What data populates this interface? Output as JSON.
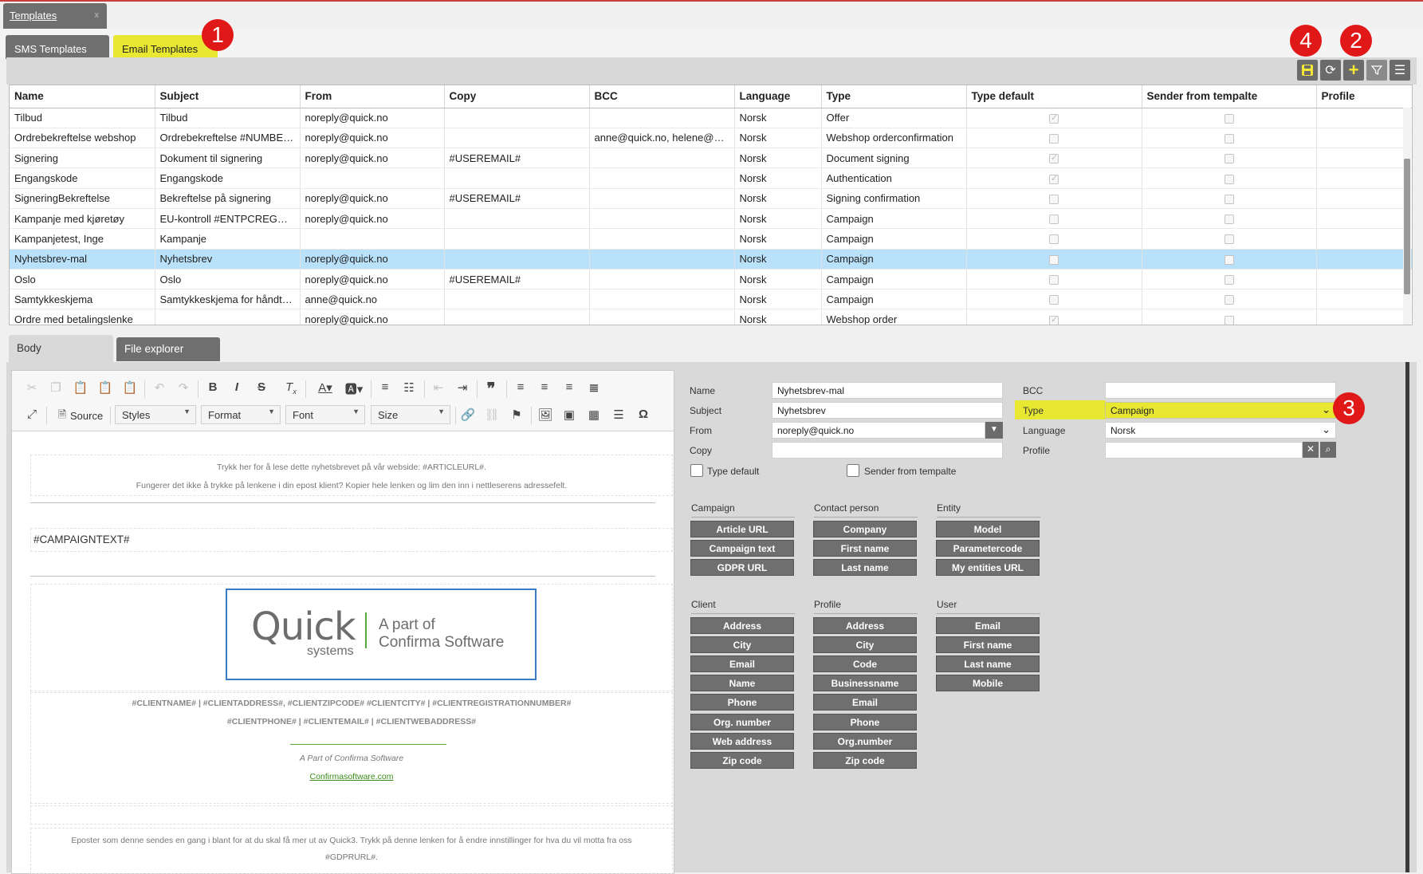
{
  "window_tab": {
    "title": "Templates",
    "close": "x"
  },
  "tabs": [
    {
      "label": "SMS Templates"
    },
    {
      "label": "Email Templates"
    }
  ],
  "toolbar": {
    "save": "save-icon",
    "refresh": "refresh-icon",
    "add": "plus-icon",
    "filter": "filter-icon",
    "menu": "menu-icon"
  },
  "grid": {
    "columns": [
      "Name",
      "Subject",
      "From",
      "Copy",
      "BCC",
      "Language",
      "Type",
      "Type default",
      "Sender from tempalte",
      "Profile"
    ],
    "rows": [
      {
        "name": "Tilbud",
        "subject": "Tilbud",
        "from": "noreply@quick.no",
        "copy": "",
        "bcc": "",
        "language": "Norsk",
        "type": "Offer",
        "type_default": true,
        "sender": false,
        "profile": ""
      },
      {
        "name": "Ordrebekreftelse webshop",
        "subject": "Ordrebekreftelse #NUMBER#",
        "from": "noreply@quick.no",
        "copy": "",
        "bcc": "anne@quick.no, helene@quick.no",
        "language": "Norsk",
        "type": "Webshop orderconfirmation",
        "type_default": false,
        "sender": false,
        "profile": ""
      },
      {
        "name": "Signering",
        "subject": "Dokument til signering",
        "from": "noreply@quick.no",
        "copy": "#USEREMAIL#",
        "bcc": "",
        "language": "Norsk",
        "type": "Document signing",
        "type_default": true,
        "sender": false,
        "profile": ""
      },
      {
        "name": "Engangskode",
        "subject": "Engangskode",
        "from": "",
        "copy": "",
        "bcc": "",
        "language": "Norsk",
        "type": "Authentication",
        "type_default": true,
        "sender": false,
        "profile": ""
      },
      {
        "name": "SigneringBekreftelse",
        "subject": "Bekreftelse på signering",
        "from": "noreply@quick.no",
        "copy": "#USEREMAIL#",
        "bcc": "",
        "language": "Norsk",
        "type": "Signing confirmation",
        "type_default": false,
        "sender": false,
        "profile": ""
      },
      {
        "name": "Kampanje med kjøretøy",
        "subject": "EU-kontroll #ENTPCREGNR#",
        "from": "noreply@quick.no",
        "copy": "",
        "bcc": "",
        "language": "Norsk",
        "type": "Campaign",
        "type_default": false,
        "sender": false,
        "profile": ""
      },
      {
        "name": "Kampanjetest, Inge",
        "subject": "Kampanje",
        "from": "",
        "copy": "",
        "bcc": "",
        "language": "Norsk",
        "type": "Campaign",
        "type_default": false,
        "sender": false,
        "profile": ""
      },
      {
        "name": "Nyhetsbrev-mal",
        "subject": "Nyhetsbrev",
        "from": "noreply@quick.no",
        "copy": "",
        "bcc": "",
        "language": "Norsk",
        "type": "Campaign",
        "type_default": false,
        "sender": false,
        "profile": "",
        "selected": true
      },
      {
        "name": "Oslo",
        "subject": "Oslo",
        "from": "noreply@quick.no",
        "copy": "#USEREMAIL#",
        "bcc": "",
        "language": "Norsk",
        "type": "Campaign",
        "type_default": false,
        "sender": false,
        "profile": ""
      },
      {
        "name": "Samtykkeskjema",
        "subject": "Samtykkeskjema for håndtering",
        "from": "anne@quick.no",
        "copy": "",
        "bcc": "",
        "language": "Norsk",
        "type": "Campaign",
        "type_default": false,
        "sender": false,
        "profile": ""
      },
      {
        "name": "Ordre med betalingslenke",
        "subject": "",
        "from": "noreply@quick.no",
        "copy": "",
        "bcc": "",
        "language": "Norsk",
        "type": "Webshop order",
        "type_default": true,
        "sender": false,
        "profile": ""
      }
    ]
  },
  "lower_tabs": [
    {
      "label": "Body"
    },
    {
      "label": "File explorer"
    }
  ],
  "editor": {
    "source_label": "Source",
    "styles_label": "Styles",
    "format_label": "Format",
    "font_label": "Font",
    "size_label": "Size",
    "doc": {
      "line1": "Trykk her for å lese dette nyhetsbrevet på vår webside: #ARTICLEURL#.",
      "line2": "Fungerer det ikke å trykke på lenkene i din epost klient? Kopier hele lenken og lim den inn i nettleserens adressefelt.",
      "campaign_text": "#CAMPAIGNTEXT#",
      "logo_word": "Quick",
      "logo_sub": "systems",
      "logo_tag1": "A part of",
      "logo_tag2": "Confirma Software",
      "client_line1": "#CLIENTNAME# | #CLIENTADDRESS#, #CLIENTZIPCODE# #CLIENTCITY# | #CLIENTREGISTRATIONNUMBER#",
      "client_line2": "#CLIENTPHONE# | #CLIENTEMAIL# | #CLIENTWEBADDRESS#",
      "part_of": "A Part of Confirma Software",
      "link": "Confirmasoftware.com",
      "footer1": "Eposter som denne sendes en gang i blant for at du skal få mer ut av Quick3. Trykk på denne lenken for å endre innstillinger for hva du vil motta fra oss",
      "footer2": "#GDPRURL#."
    }
  },
  "form": {
    "name_label": "Name",
    "name_value": "Nyhetsbrev-mal",
    "subject_label": "Subject",
    "subject_value": "Nyhetsbrev",
    "from_label": "From",
    "from_value": "noreply@quick.no",
    "copy_label": "Copy",
    "copy_value": "",
    "bcc_label": "BCC",
    "bcc_value": "",
    "type_label": "Type",
    "type_value": "Campaign",
    "language_label": "Language",
    "language_value": "Norsk",
    "profile_label": "Profile",
    "profile_value": "",
    "type_default_label": "Type default",
    "sender_label": "Sender from tempalte"
  },
  "merge_groups": [
    {
      "title": "Campaign",
      "buttons": [
        "Article URL",
        "Campaign text",
        "GDPR URL"
      ]
    },
    {
      "title": "Contact person",
      "buttons": [
        "Company",
        "First name",
        "Last name"
      ]
    },
    {
      "title": "Entity",
      "buttons": [
        "Model",
        "Parametercode",
        "My entities URL"
      ]
    },
    {
      "title": "Client",
      "buttons": [
        "Address",
        "City",
        "Email",
        "Name",
        "Phone",
        "Org. number",
        "Web address",
        "Zip code"
      ]
    },
    {
      "title": "Profile",
      "buttons": [
        "Address",
        "City",
        "Code",
        "Businessname",
        "Email",
        "Phone",
        "Org.number",
        "Zip code"
      ]
    },
    {
      "title": "User",
      "buttons": [
        "Email",
        "First name",
        "Last name",
        "Mobile"
      ]
    }
  ],
  "badges": [
    "1",
    "2",
    "3",
    "4"
  ],
  "colors": {
    "highlight": "#e8e832",
    "selected_row": "#b9e1fa",
    "badge": "#e11818"
  }
}
